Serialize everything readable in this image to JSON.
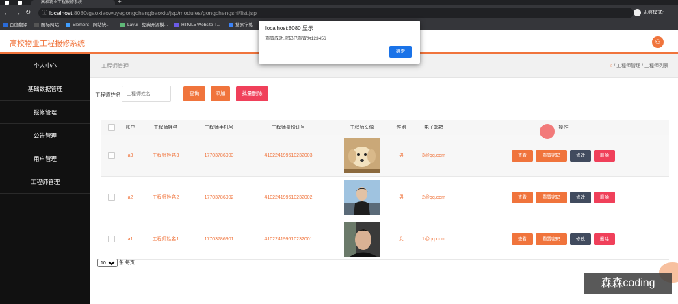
{
  "browser": {
    "tab_title": "高校物业工程报修系统",
    "url_host": "localhost",
    "url_path": ":8080/gaoxiaowuyegongchengbaoxiu/jsp/modules/gongchengshi/list.jsp",
    "incognito_label": "无痕模式",
    "bookmarks": [
      {
        "label": "百度翻译",
        "color": "#2a6bd8"
      },
      {
        "label": "图标网站",
        "color": "#555555"
      },
      {
        "label": "Element - 网站快...",
        "color": "#409eff"
      },
      {
        "label": "Layui - 经典开源模...",
        "color": "#5fb878"
      },
      {
        "label": "HTML5 Website T...",
        "color": "#6c5ce7"
      },
      {
        "label": "搜索学练",
        "color": "#3b82f6"
      }
    ]
  },
  "header": {
    "brand": "高校物业工程报修系统"
  },
  "sidebar": {
    "items": [
      {
        "label": "个人中心"
      },
      {
        "label": "基础数据管理"
      },
      {
        "label": "报修管理"
      },
      {
        "label": "公告管理"
      },
      {
        "label": "用户管理"
      },
      {
        "label": "工程师管理"
      }
    ]
  },
  "breadcrumb": {
    "title": "工程师管理",
    "path": "/ 工程师管理 / 工程师列表"
  },
  "search": {
    "label": "工程师姓名",
    "placeholder": "工程师姓名",
    "query_label": "查询",
    "add_label": "添加",
    "batch_delete_label": "批量删除"
  },
  "table": {
    "headers": [
      "",
      "账户",
      "工程师姓名",
      "工程师手机号",
      "工程师身份证号",
      "工程师头像",
      "性别",
      "电子邮箱",
      "操作"
    ],
    "rows": [
      {
        "account": "a3",
        "name": "工程师姓名3",
        "phone": "17703786903",
        "id_card": "410224199610232003",
        "gender": "男",
        "email": "3@qq.com",
        "avatar": "puppy"
      },
      {
        "account": "a2",
        "name": "工程师姓名2",
        "phone": "17703786902",
        "id_card": "410224199610232002",
        "gender": "男",
        "email": "2@qq.com",
        "avatar": "man-sky"
      },
      {
        "account": "a1",
        "name": "工程师姓名1",
        "phone": "17703786901",
        "id_card": "410224199610232001",
        "gender": "女",
        "email": "1@qq.com",
        "avatar": "man-portrait"
      }
    ],
    "actions": {
      "view": "查看",
      "reset": "重置密码",
      "edit": "修改",
      "delete": "删除"
    }
  },
  "pager": {
    "page_size": "10",
    "suffix": "条 每页"
  },
  "alert": {
    "title": "localhost:8080 显示",
    "message": "重置成功,密码已重置为123456",
    "ok": "确定"
  },
  "watermark": "森森coding",
  "colors": {
    "accent": "#f0743c",
    "danger": "#f0405a",
    "dark_button": "#414b5e",
    "sidebar": "#111111"
  }
}
